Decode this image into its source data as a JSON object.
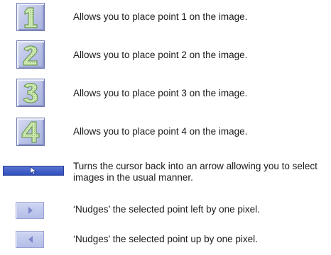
{
  "items": [
    {
      "icon": "digit-1-icon",
      "digit": "1",
      "description": "Allows you to place point 1 on the image."
    },
    {
      "icon": "digit-2-icon",
      "digit": "2",
      "description": "Allows you to place point 2 on the image."
    },
    {
      "icon": "digit-3-icon",
      "digit": "3",
      "description": "Allows you to place point 3 on the image."
    },
    {
      "icon": "digit-4-icon",
      "digit": "4",
      "description": "Allows you to place point 4 on the image."
    },
    {
      "icon": "arrow-cursor-icon",
      "description": "Turns the cursor back into an arrow allowing you to select images in the usual manner."
    },
    {
      "icon": "nudge-right-icon",
      "description": "‘Nudges’ the selected point left by one pixel."
    },
    {
      "icon": "nudge-left-icon",
      "description": "‘Nudges’ the selected point up by one pixel."
    }
  ],
  "colors": {
    "button_face": "#b9c1e6",
    "button_border": "#6f7bb0",
    "digit_fill": "#c6e6a8",
    "digit_outline": "#7fa86a",
    "arrow_button": "#3d5bc8"
  }
}
